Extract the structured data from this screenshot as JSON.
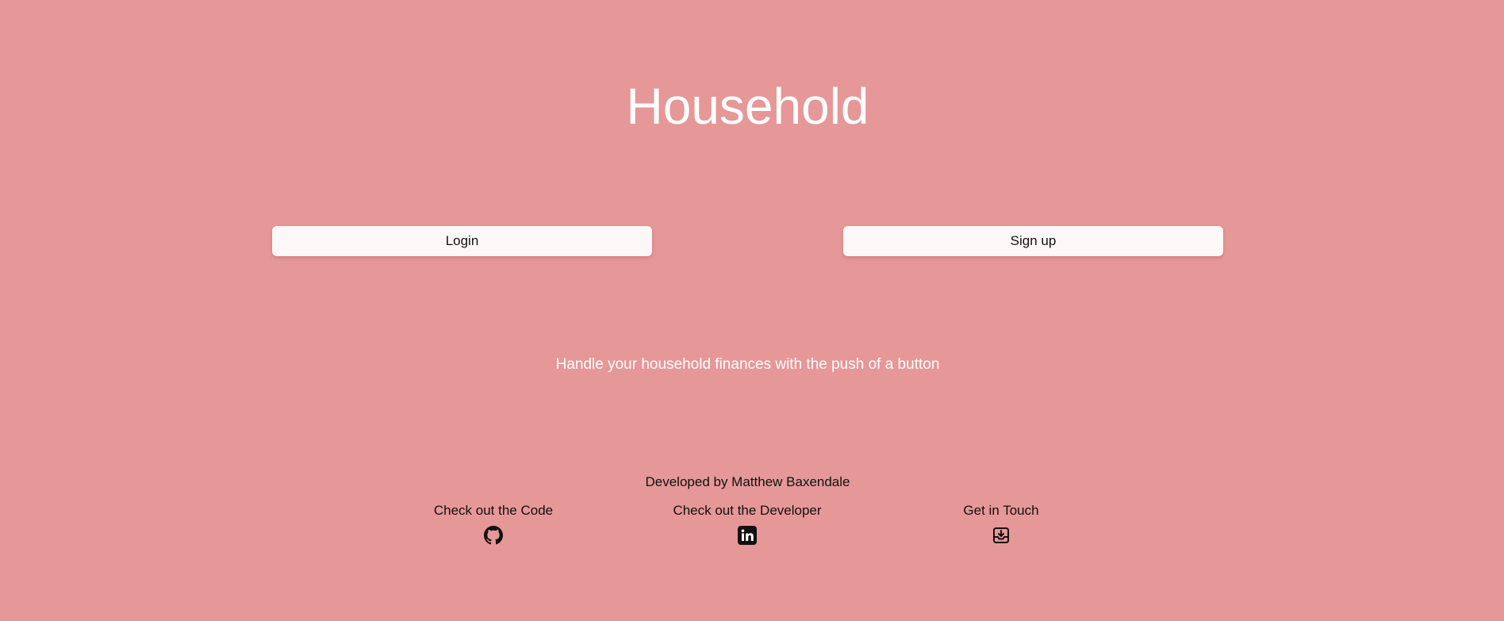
{
  "header": {
    "title": "Household"
  },
  "actions": {
    "login_label": "Login",
    "signup_label": "Sign up"
  },
  "tagline": "Handle your household finances with the push of a button",
  "footer": {
    "credit": "Developed by Matthew Baxendale",
    "links": [
      {
        "label": "Check out the Code",
        "icon": "github-icon"
      },
      {
        "label": "Check out the Developer",
        "icon": "linkedin-icon"
      },
      {
        "label": "Get in Touch",
        "icon": "inbox-download-icon"
      }
    ]
  },
  "colors": {
    "background": "#e69797",
    "title_text": "#ffffff",
    "button_background": "#fcf8f8",
    "body_text": "#111111"
  }
}
